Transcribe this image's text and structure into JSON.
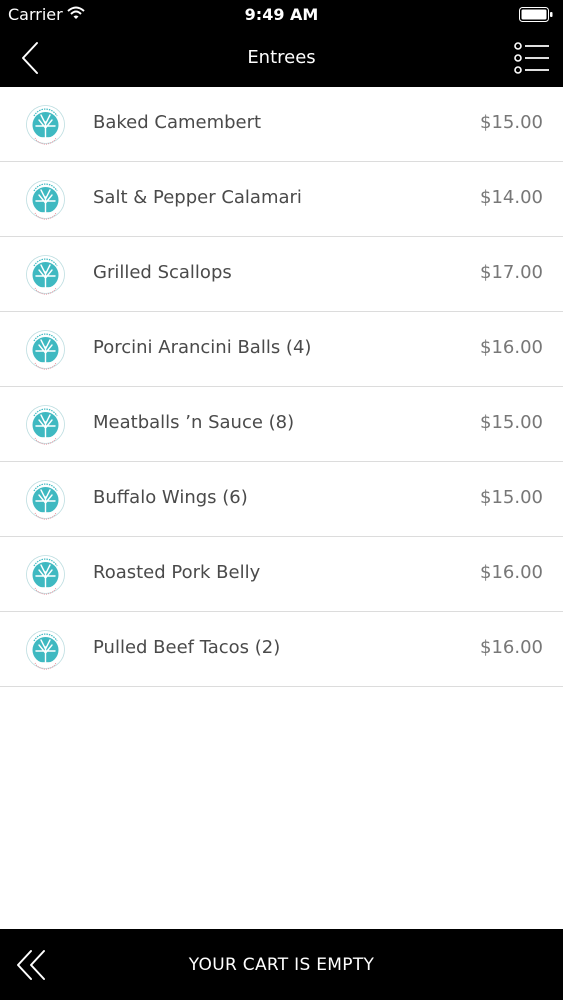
{
  "status_bar": {
    "carrier": "Carrier",
    "time": "9:49 AM",
    "icons": [
      "wifi-icon",
      "battery-icon"
    ]
  },
  "nav": {
    "title": "Entrees",
    "back_icon": "chevron-left-icon",
    "menu_icon": "list-menu-icon"
  },
  "colors": {
    "bar_background": "#000000",
    "logo_teal": "#3fb9c1",
    "divider": "#dcdcdc"
  },
  "menu": {
    "items": [
      {
        "name": "Baked Camembert",
        "price": "$15.00"
      },
      {
        "name": "Salt & Pepper Calamari",
        "price": "$14.00"
      },
      {
        "name": "Grilled Scallops",
        "price": "$17.00"
      },
      {
        "name": "Porcini Arancini Balls (4)",
        "price": "$16.00"
      },
      {
        "name": "Meatballs ’n Sauce (8)",
        "price": "$15.00"
      },
      {
        "name": "Buffalo Wings (6)",
        "price": "$15.00"
      },
      {
        "name": "Roasted Pork Belly",
        "price": "$16.00"
      },
      {
        "name": "Pulled Beef Tacos (2)",
        "price": "$16.00"
      }
    ],
    "item_icon": "willowgrill-logo-icon"
  },
  "cart": {
    "status": "YOUR CART IS EMPTY",
    "expand_icon": "double-chevron-left-icon"
  }
}
